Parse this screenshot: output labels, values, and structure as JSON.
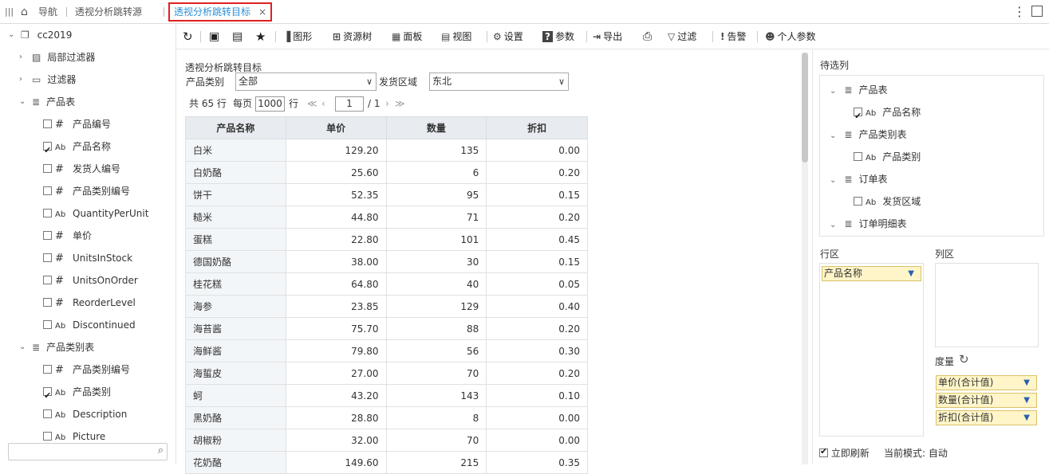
{
  "topbar": {
    "nav_label": "导航",
    "source_tab": "透视分析跳转源",
    "active_tab": "透视分析跳转目标",
    "close": "×"
  },
  "tree": {
    "root": "cc2019",
    "items": [
      {
        "label": "局部过滤器",
        "icon": "local-filter-icon"
      },
      {
        "label": "过滤器",
        "icon": "folder-icon"
      },
      {
        "label": "产品表",
        "icon": "table-icon"
      },
      {
        "label": "产品编号",
        "type": "#",
        "checked": false
      },
      {
        "label": "产品名称",
        "type": "Ab",
        "checked": true
      },
      {
        "label": "发货人编号",
        "type": "#",
        "checked": false
      },
      {
        "label": "产品类别编号",
        "type": "#",
        "checked": false
      },
      {
        "label": "QuantityPerUnit",
        "type": "Ab",
        "checked": false
      },
      {
        "label": "单价",
        "type": "#",
        "checked": false
      },
      {
        "label": "UnitsInStock",
        "type": "#",
        "checked": false
      },
      {
        "label": "UnitsOnOrder",
        "type": "#",
        "checked": false
      },
      {
        "label": "ReorderLevel",
        "type": "#",
        "checked": false
      },
      {
        "label": "Discontinued",
        "type": "Ab",
        "checked": false
      },
      {
        "label": "产品类别表",
        "icon": "table-icon"
      },
      {
        "label": "产品类别编号",
        "type": "#",
        "checked": false
      },
      {
        "label": "产品类别",
        "type": "Ab",
        "checked": true
      },
      {
        "label": "Description",
        "type": "Ab",
        "checked": false
      },
      {
        "label": "Picture",
        "type": "Ab",
        "checked": false
      }
    ]
  },
  "toolbar": {
    "chart": "图形",
    "resource_tree": "资源树",
    "panel": "面板",
    "view": "视图",
    "settings": "设置",
    "params": "参数",
    "export": "导出",
    "filter": "过滤",
    "alert": "告警",
    "personal_params": "个人参数"
  },
  "report": {
    "title": "透视分析跳转目标",
    "filter1_label": "产品类别",
    "filter1_value": "全部",
    "filter2_label": "发货区域",
    "filter2_value": "东北",
    "total": "共 65 行",
    "per_page_label": "每页",
    "per_page": "1000",
    "rows_unit": "行",
    "page": "1",
    "page_total": "/ 1",
    "columns": [
      "产品名称",
      "单价",
      "数量",
      "折扣"
    ],
    "rows": [
      [
        "白米",
        "129.20",
        "135",
        "0.00"
      ],
      [
        "白奶酪",
        "25.60",
        "6",
        "0.20"
      ],
      [
        "饼干",
        "52.35",
        "95",
        "0.15"
      ],
      [
        "糙米",
        "44.80",
        "71",
        "0.20"
      ],
      [
        "蛋糕",
        "22.80",
        "101",
        "0.45"
      ],
      [
        "德国奶酪",
        "38.00",
        "30",
        "0.15"
      ],
      [
        "桂花糕",
        "64.80",
        "40",
        "0.05"
      ],
      [
        "海参",
        "23.85",
        "129",
        "0.40"
      ],
      [
        "海苔酱",
        "75.70",
        "88",
        "0.20"
      ],
      [
        "海鲜酱",
        "79.80",
        "56",
        "0.30"
      ],
      [
        "海蜇皮",
        "27.00",
        "70",
        "0.20"
      ],
      [
        "蚵",
        "43.20",
        "143",
        "0.10"
      ],
      [
        "黑奶酪",
        "28.80",
        "8",
        "0.00"
      ],
      [
        "胡椒粉",
        "32.00",
        "70",
        "0.00"
      ],
      [
        "花奶酪",
        "149.60",
        "215",
        "0.35"
      ]
    ]
  },
  "right": {
    "pending_title": "待选列",
    "pending": [
      {
        "label": "产品表",
        "kind": "table"
      },
      {
        "label": "产品名称",
        "kind": "field",
        "checked": true
      },
      {
        "label": "产品类别表",
        "kind": "table"
      },
      {
        "label": "产品类别",
        "kind": "field",
        "checked": false
      },
      {
        "label": "订单表",
        "kind": "table"
      },
      {
        "label": "发货区域",
        "kind": "field",
        "checked": false
      },
      {
        "label": "订单明细表",
        "kind": "table"
      }
    ],
    "row_zone": "行区",
    "col_zone": "列区",
    "row_field": "产品名称",
    "measure_zone": "度量",
    "measures": [
      "单价(合计值)",
      "数量(合计值)",
      "折扣(合计值)"
    ],
    "refresh_label": "立即刷新",
    "mode_label": "当前模式: 自动"
  }
}
